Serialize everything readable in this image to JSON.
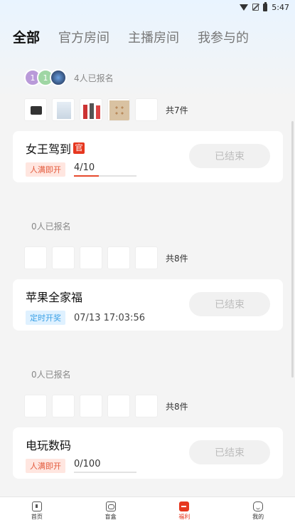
{
  "status": {
    "time": "5:47"
  },
  "tabs": [
    {
      "label": "全部",
      "active": true
    },
    {
      "label": "官方房间",
      "active": false
    },
    {
      "label": "主播房间",
      "active": false
    },
    {
      "label": "我参与的",
      "active": false
    }
  ],
  "lotteries": [
    {
      "registered_text": "4人已报名",
      "avatars": [
        "1",
        "1",
        ""
      ],
      "prizes_count_text": "共7件",
      "title": "女王驾到",
      "official_badge": "官",
      "mode_tag": "人满即开",
      "progress_text": "4/10",
      "progress_ratio": 0.4,
      "button_label": "已结束"
    },
    {
      "registered_text": "0人已报名",
      "prizes_count_text": "共8件",
      "title": "苹果全家福",
      "mode_tag": "定时开奖",
      "time_text": "07/13 17:03:56",
      "button_label": "已结束"
    },
    {
      "registered_text": "0人已报名",
      "prizes_count_text": "共8件",
      "title": "电玩数码",
      "mode_tag": "人满即开",
      "progress_text": "0/100",
      "progress_ratio": 0.0,
      "button_label": "已结束"
    }
  ],
  "bottom_nav": [
    {
      "label": "首页",
      "active": false
    },
    {
      "label": "盲盒",
      "active": false
    },
    {
      "label": "福利",
      "active": true
    },
    {
      "label": "我的",
      "active": false
    }
  ],
  "colors": {
    "accent": "#e6371f",
    "tag_orange_bg": "#ffe6e0",
    "tag_blue_bg": "#dff1ff"
  }
}
